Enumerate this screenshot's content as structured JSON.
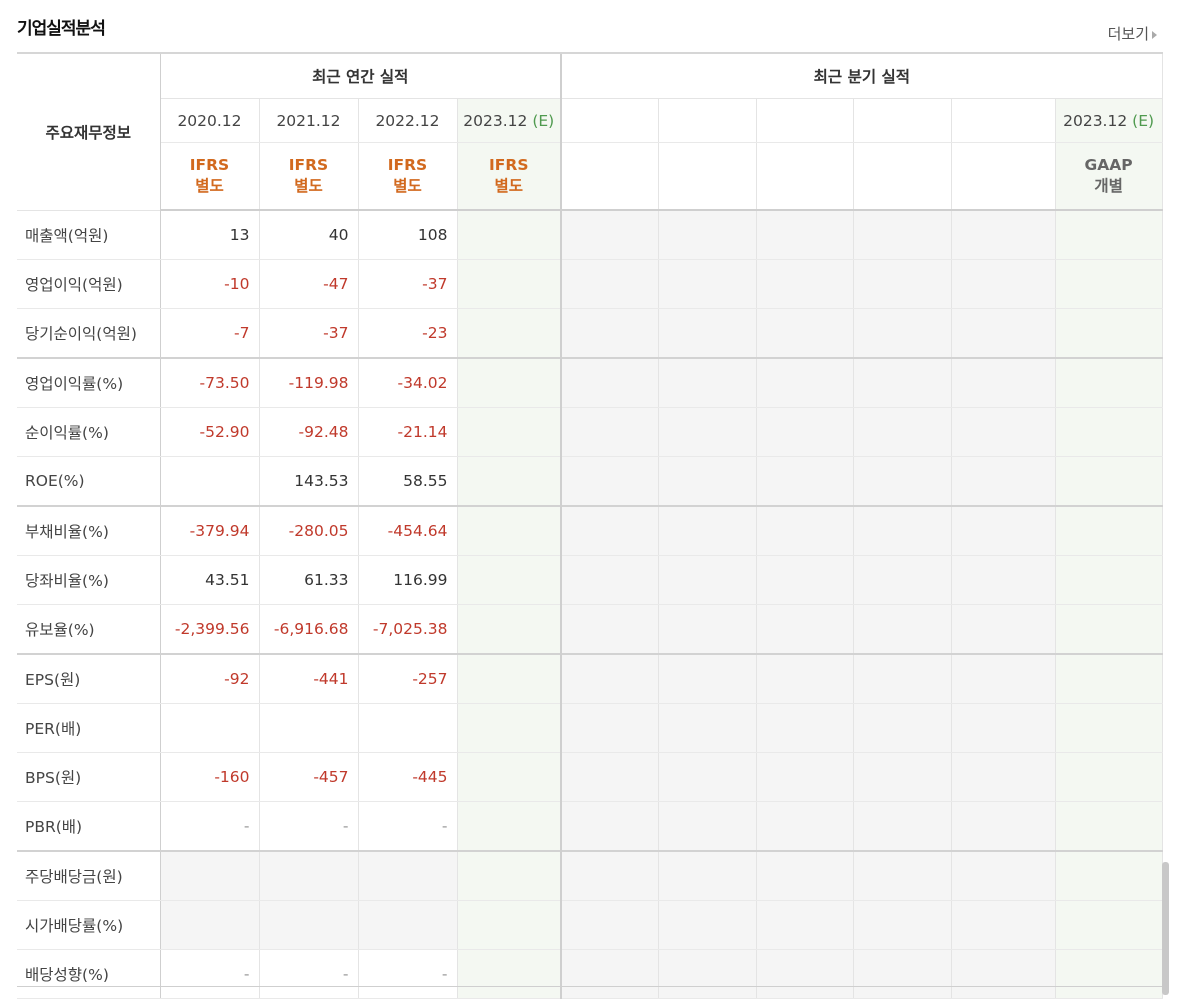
{
  "header": {
    "title": "기업실적분석",
    "more_label": "더보기"
  },
  "table": {
    "row_header": "주요재무정보",
    "group_annual": "최근 연간 실적",
    "group_quarter": "최근 분기 실적",
    "annual_years": [
      "2020.12",
      "2021.12",
      "2022.12",
      "2023.12"
    ],
    "annual_estimate_marker": "(E)",
    "quarter_last_year": "2023.12",
    "quarter_estimate_marker": "(E)",
    "annual_standards": [
      {
        "line1": "IFRS",
        "line2": "별도"
      },
      {
        "line1": "IFRS",
        "line2": "별도"
      },
      {
        "line1": "IFRS",
        "line2": "별도"
      },
      {
        "line1": "IFRS",
        "line2": "별도"
      }
    ],
    "quarter_standard": {
      "line1": "GAAP",
      "line2": "개별"
    },
    "rows": [
      {
        "label": "매출액(억원)",
        "values": [
          "13",
          "40",
          "108"
        ]
      },
      {
        "label": "영업이익(억원)",
        "values": [
          "-10",
          "-47",
          "-37"
        ]
      },
      {
        "label": "당기순이익(억원)",
        "values": [
          "-7",
          "-37",
          "-23"
        ]
      },
      {
        "label": "영업이익률(%)",
        "values": [
          "-73.50",
          "-119.98",
          "-34.02"
        ]
      },
      {
        "label": "순이익률(%)",
        "values": [
          "-52.90",
          "-92.48",
          "-21.14"
        ]
      },
      {
        "label": "ROE(%)",
        "values": [
          "",
          "143.53",
          "58.55"
        ]
      },
      {
        "label": "부채비율(%)",
        "values": [
          "-379.94",
          "-280.05",
          "-454.64"
        ]
      },
      {
        "label": "당좌비율(%)",
        "values": [
          "43.51",
          "61.33",
          "116.99"
        ]
      },
      {
        "label": "유보율(%)",
        "values": [
          "-2,399.56",
          "-6,916.68",
          "-7,025.38"
        ]
      },
      {
        "label": "EPS(원)",
        "values": [
          "-92",
          "-441",
          "-257"
        ]
      },
      {
        "label": "PER(배)",
        "values": [
          "",
          "",
          ""
        ]
      },
      {
        "label": "BPS(원)",
        "values": [
          "-160",
          "-457",
          "-445"
        ]
      },
      {
        "label": "PBR(배)",
        "values": [
          "-",
          "-",
          "-"
        ]
      },
      {
        "label": "주당배당금(원)",
        "values": [
          "",
          "",
          ""
        ]
      },
      {
        "label": "시가배당률(%)",
        "values": [
          "",
          "",
          ""
        ]
      },
      {
        "label": "배당성향(%)",
        "values": [
          "-",
          "-",
          "-"
        ]
      }
    ]
  }
}
